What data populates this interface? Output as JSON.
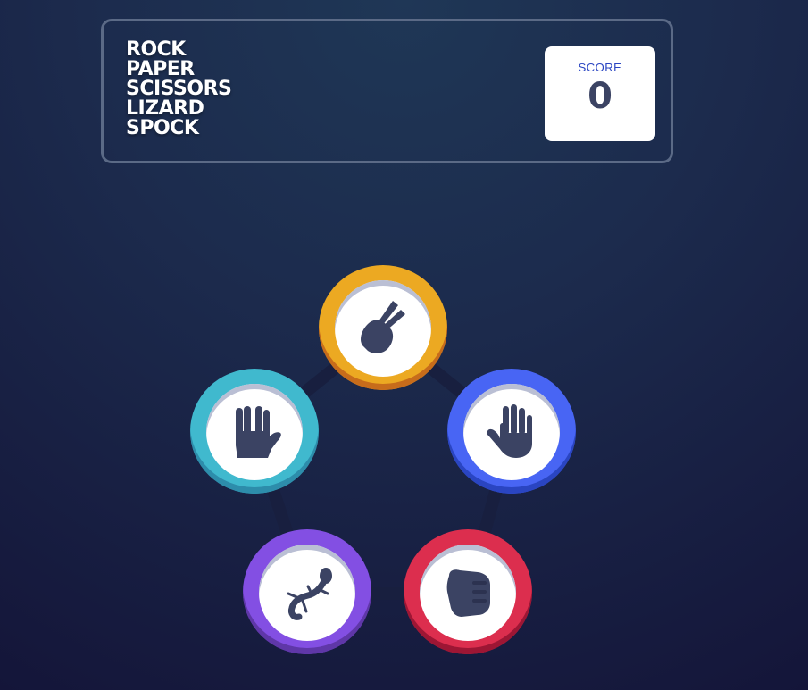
{
  "header": {
    "title_lines": [
      "ROCK",
      "PAPER",
      "SCISSORS",
      "LIZARD",
      "SPOCK"
    ],
    "score_label": "SCORE",
    "score_value": "0"
  },
  "tokens": [
    {
      "name": "scissors",
      "icon": "scissors-hand-icon",
      "color": "#eca922"
    },
    {
      "name": "paper",
      "icon": "paper-hand-icon",
      "color": "#4865f4"
    },
    {
      "name": "rock",
      "icon": "rock-fist-icon",
      "color": "#dc2e4e"
    },
    {
      "name": "lizard",
      "icon": "lizard-icon",
      "color": "#834fe3"
    },
    {
      "name": "spock",
      "icon": "spock-hand-icon",
      "color": "#40b9ce"
    }
  ]
}
